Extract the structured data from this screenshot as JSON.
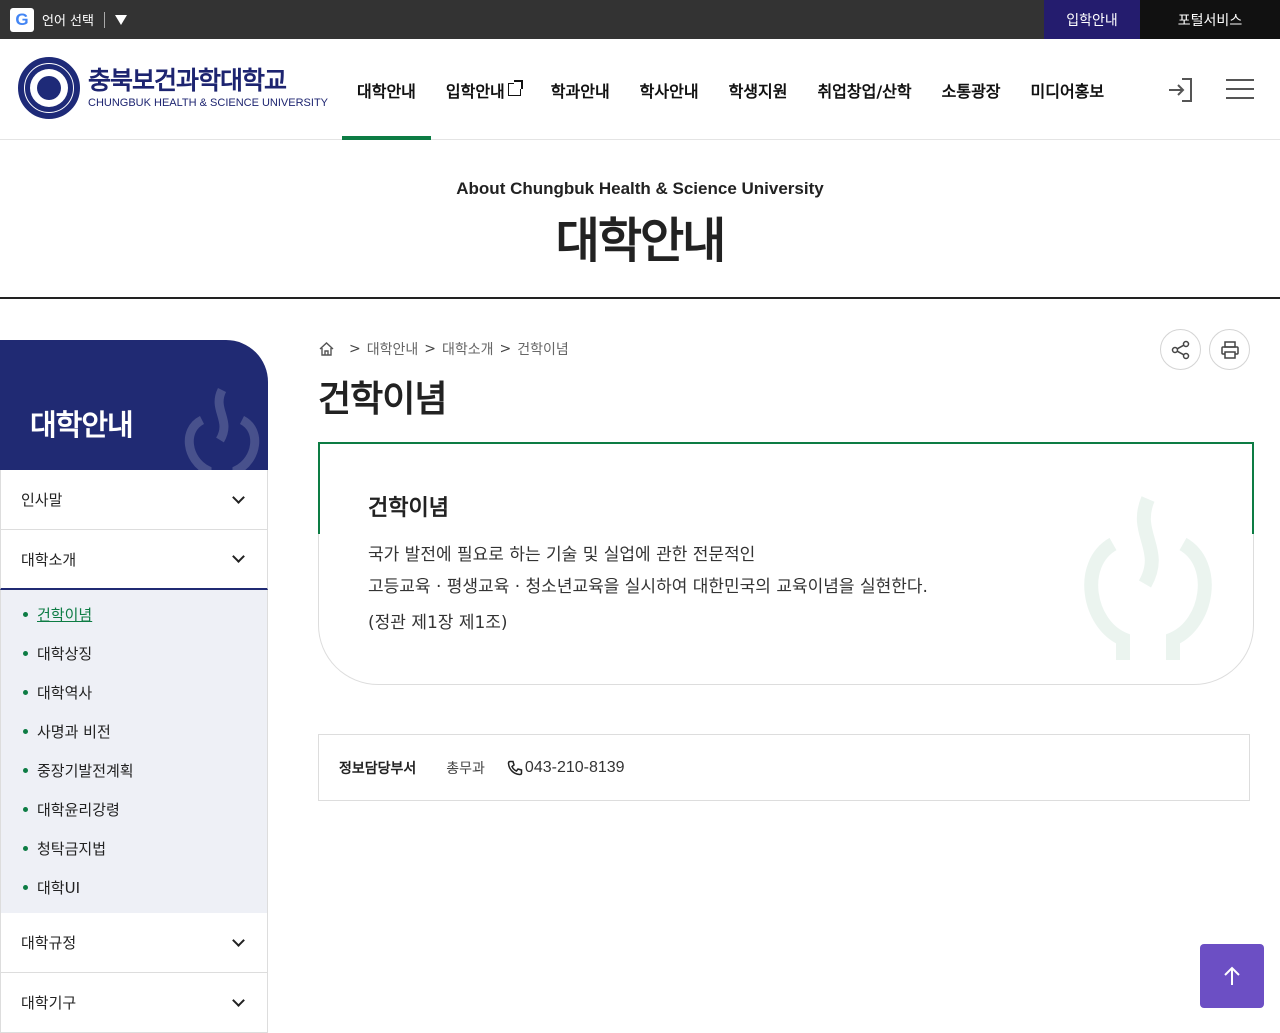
{
  "topbar": {
    "lang_label": "언어 선택",
    "admission": "입학안내",
    "portal": "포털서비스"
  },
  "header": {
    "logo_ko": "충북보건과학대학교",
    "logo_en": "CHUNGBUK HEALTH & SCIENCE UNIVERSITY",
    "nav": [
      "대학안내",
      "입학안내",
      "학과안내",
      "학사안내",
      "학생지원",
      "취업창업/산학",
      "소통광장",
      "미디어홍보"
    ]
  },
  "hero": {
    "en": "About Chungbuk Health & Science University",
    "ko": "대학안내"
  },
  "sidebar": {
    "title": "대학안내",
    "groups": [
      "인사말",
      "대학소개",
      "대학규정",
      "대학기구"
    ],
    "sub_items": [
      "건학이념",
      "대학상징",
      "대학역사",
      "사명과 비전",
      "중장기발전계획",
      "대학윤리강령",
      "청탁금지법",
      "대학UI"
    ]
  },
  "breadcrumb": [
    "대학안내",
    "대학소개",
    "건학이념"
  ],
  "content": {
    "title": "건학이념",
    "card_heading": "건학이념",
    "line1": "국가 발전에 필요로 하는 기술 및 실업에 관한 전문적인",
    "line2": "고등교육 · 평생교육 · 청소년교육을 실시하여 대한민국의 교육이념을 실현한다.",
    "line3": "(정관 제1장 제1조)"
  },
  "info": {
    "label": "정보담당부서",
    "dept": "총무과",
    "phone": "043-210-8139"
  },
  "colors": {
    "accent_green": "#0d7c44",
    "navy": "#202a73",
    "topbar": "#333333",
    "to_top": "#6c4fc4"
  }
}
